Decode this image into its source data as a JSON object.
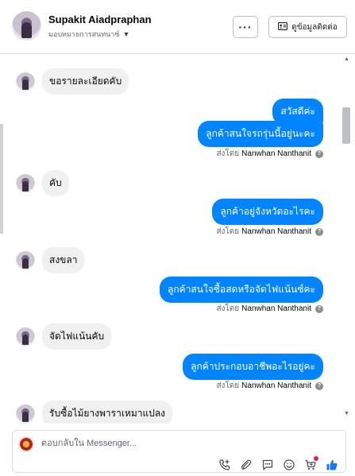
{
  "header": {
    "name": "Supakit Aiadpraphan",
    "assign_label": "มอบหมายการสนทนาซ์",
    "more_label": "···",
    "contact_label": "ดูข้อมูลติดต่อ"
  },
  "messages": [
    {
      "side": "in",
      "text": "ขอรายละเอียดคับ"
    },
    {
      "side": "out",
      "text": "สวัสดีค่ะ"
    },
    {
      "side": "out",
      "text": "ลูกค้าสนใจรถรุ่นนี้อยู่นะคะ"
    },
    {
      "side": "out",
      "text": "ลูกค้าอยู่จังหวัดอะไรคะ"
    },
    {
      "side": "in",
      "text": "คับ"
    },
    {
      "side": "in",
      "text": "สงขลา"
    },
    {
      "side": "out",
      "text": "ลูกค้าสนใจซื้อสดหรือจัดไฟแน้นซ์คะ"
    },
    {
      "side": "in",
      "text": "จัดไฟแน้นคับ"
    },
    {
      "side": "out",
      "text": "ลูกค้าประกอบอาชีพอะไรอยู่คะ"
    },
    {
      "side": "in",
      "text": "รับซื้อไม้ยางพาราเหมาแปลง"
    }
  ],
  "sent_by": {
    "prefix": "ส่งโดย",
    "agent": "Nanwhan Nanthanit"
  },
  "composer": {
    "placeholder": "ตอบกลับใน Messenger..."
  },
  "icons": {
    "contact": "contact-card-icon",
    "tools": [
      "add-call-icon",
      "attachment-icon",
      "saved-reply-icon",
      "emoji-icon",
      "cart-icon",
      "like-icon"
    ]
  },
  "colors": {
    "outgoing_bubble": "#0084ff",
    "incoming_bubble": "#f0f0f0",
    "like_icon": "#1877f2",
    "notification_dot": "#e41e3f"
  }
}
